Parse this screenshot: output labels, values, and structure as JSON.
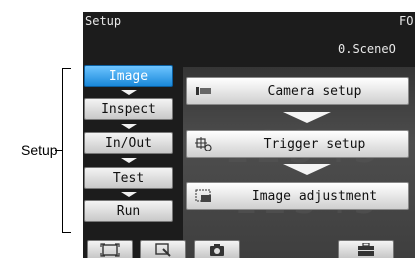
{
  "callout": {
    "label": "Setup"
  },
  "screen": {
    "title": "Setup",
    "title_right": "FO",
    "scene": "0.SceneO"
  },
  "left_menu": [
    {
      "label": "Image",
      "active": true
    },
    {
      "label": "Inspect",
      "active": false
    },
    {
      "label": "In/Out",
      "active": false
    },
    {
      "label": "Test",
      "active": false
    },
    {
      "label": "Run",
      "active": false
    }
  ],
  "right_menu": [
    {
      "label": "Camera setup",
      "icon": "camera-setup-icon"
    },
    {
      "label": "Trigger setup",
      "icon": "trigger-icon"
    },
    {
      "label": "Image adjustment",
      "icon": "image-adjust-icon"
    }
  ],
  "bottom_bar": [
    {
      "icon": "fullscreen-icon"
    },
    {
      "icon": "zoom-icon"
    },
    {
      "icon": "camera-icon"
    },
    {
      "icon": "toolbox-icon"
    }
  ],
  "colors": {
    "active": "#1a88da",
    "screen_bg": "#1c1c1c"
  }
}
